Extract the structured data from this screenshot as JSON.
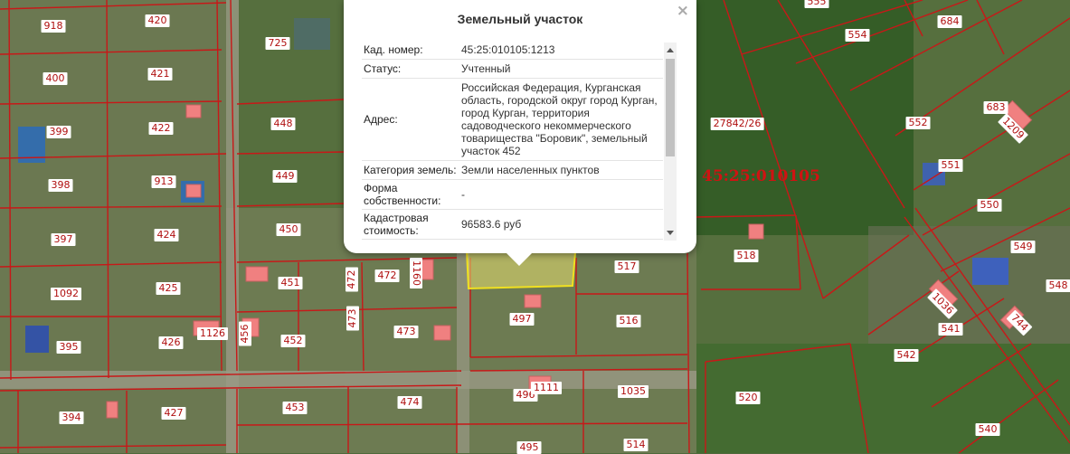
{
  "popup": {
    "title": "Земельный участок",
    "close": "×",
    "rows": [
      {
        "key": "Кад. номер:",
        "value": "45:25:010105:1213"
      },
      {
        "key": "Статус:",
        "value": "Учтенный"
      },
      {
        "key": "Адрес:",
        "value": "Российская Федерация, Курганская область, городской округ город Курган, город Курган, территория садоводческого некоммерческого товарищества \"Боровик\", земельный участок 452"
      },
      {
        "key": "Категория земель:",
        "value": "Земли населенных пунктов"
      },
      {
        "key": "Форма собственности:",
        "value": "-"
      },
      {
        "key": "Кадастровая стоимость:",
        "value": "96583.6 руб"
      }
    ]
  },
  "map": {
    "quarter_number": "45:25:010105",
    "accent_color": "#d01212",
    "selected_color": "#e8e070",
    "parcel_labels": [
      "918",
      "420",
      "725",
      "555",
      "684",
      "554",
      "400",
      "421",
      "399",
      "422",
      "448",
      "552",
      "683",
      "1209",
      "27842/26",
      "551",
      "398",
      "913",
      "449",
      "550",
      "397",
      "424",
      "450",
      "549",
      "1092",
      "425",
      "472",
      "451",
      "472",
      "1160",
      "517",
      "518",
      "548",
      "1036",
      "541",
      "744",
      "395",
      "426",
      "1126",
      "456",
      "452",
      "473",
      "473",
      "497",
      "516",
      "542",
      "394",
      "427",
      "453",
      "474",
      "496",
      "1111",
      "1035",
      "520",
      "540",
      "495",
      "514"
    ]
  }
}
